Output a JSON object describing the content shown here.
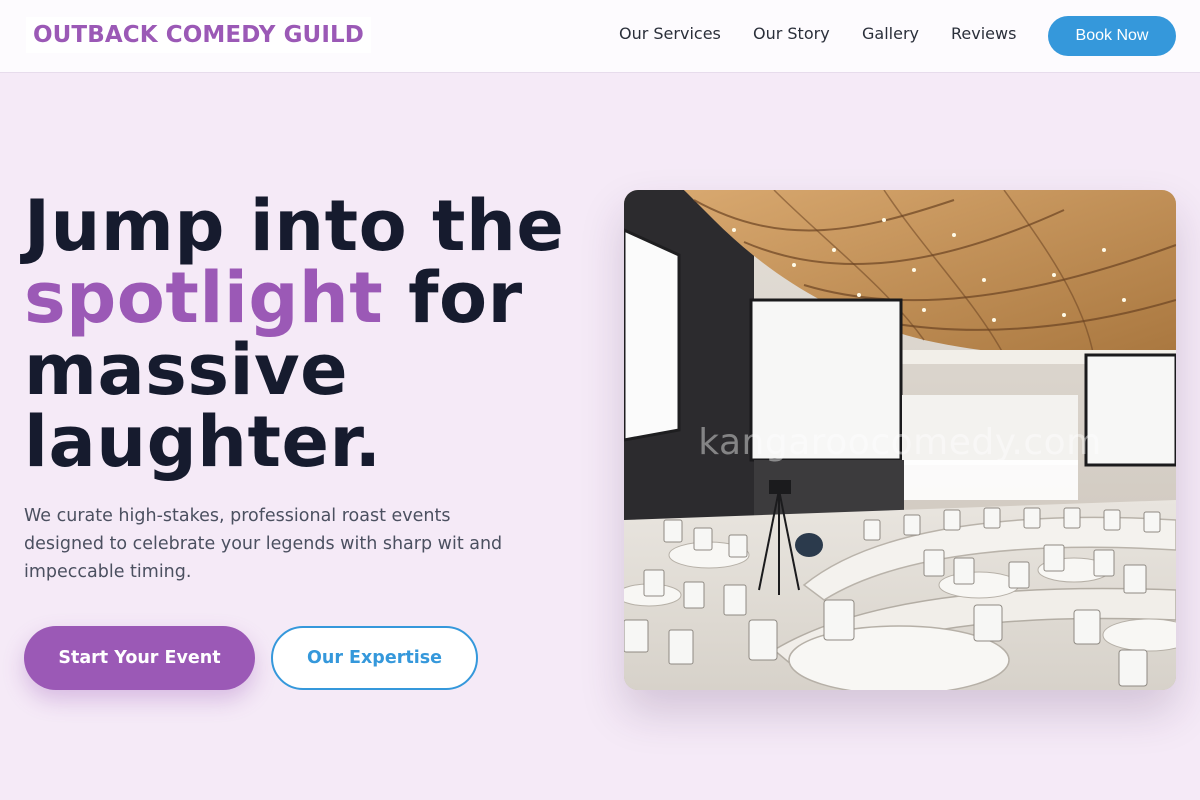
{
  "header": {
    "brand": "OUTBACK COMEDY GUILD",
    "nav": [
      {
        "label": "Our Services"
      },
      {
        "label": "Our Story"
      },
      {
        "label": "Gallery"
      },
      {
        "label": "Reviews"
      }
    ],
    "cta_label": "Book Now"
  },
  "hero": {
    "title_line1": "Jump into the",
    "title_accent": "spotlight",
    "title_line2_rest": " for",
    "title_line3": "massive",
    "title_line4": "laughter.",
    "subtitle": "We curate high-stakes, professional roast events designed to celebrate your legends with sharp wit and impeccable timing.",
    "primary_button": "Start Your Event",
    "secondary_button": "Our Expertise",
    "image_watermark": "kangaroocomedy.com"
  },
  "colors": {
    "accent_purple": "#9b59b6",
    "accent_blue": "#3598db",
    "page_background": "#f5eaf7",
    "heading": "#161b2e"
  },
  "icons": {
    "hero_image": "auditorium-photo"
  }
}
